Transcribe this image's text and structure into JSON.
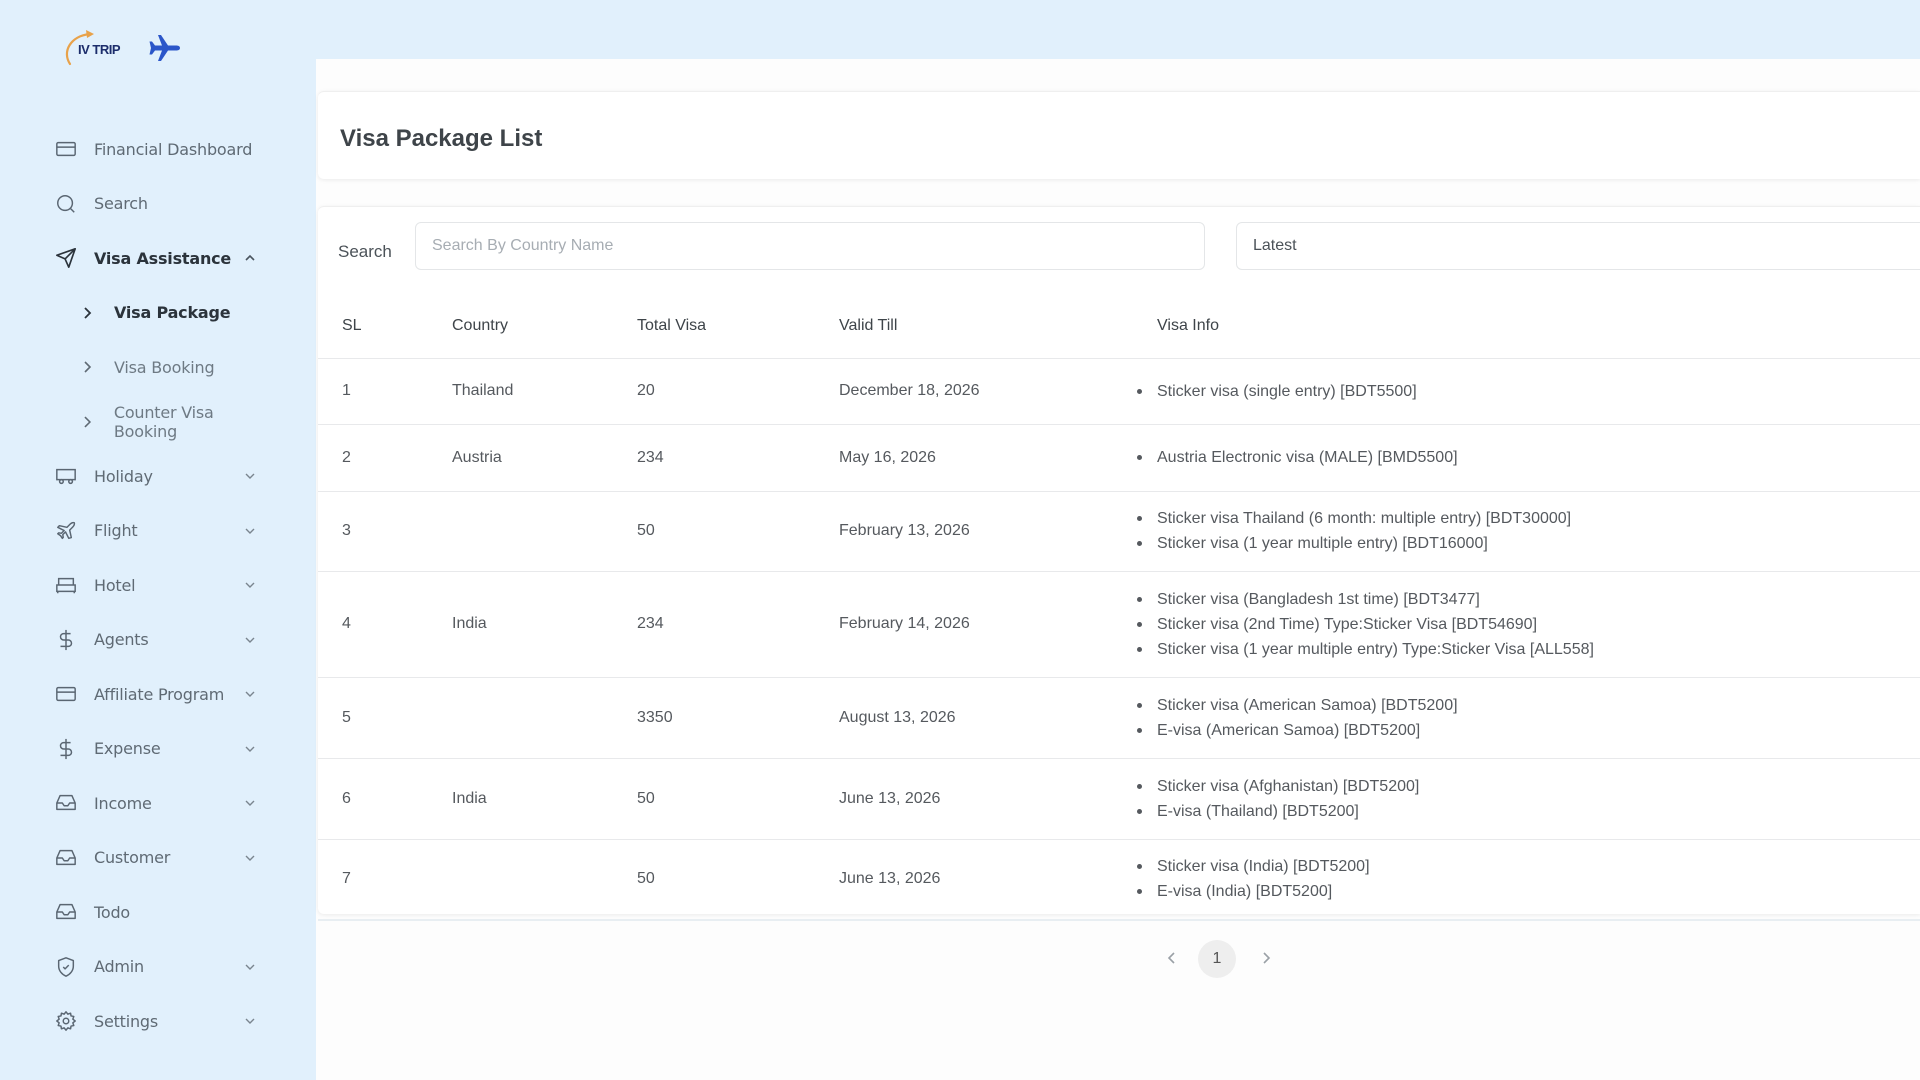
{
  "brand": {
    "name": "IV TRIP",
    "plane_color": "#2b56c9",
    "swoosh_color": "#e8a24a"
  },
  "sidebar": {
    "items": [
      {
        "label": "Financial Dashboard",
        "icon": "credit-card-icon",
        "has_chevron": false
      },
      {
        "label": "Search",
        "icon": "search-icon",
        "has_chevron": false
      },
      {
        "label": "Visa Assistance",
        "icon": "send-icon",
        "has_chevron": true,
        "expanded": true,
        "children": [
          {
            "label": "Visa Package",
            "active": true
          },
          {
            "label": "Visa Booking",
            "active": false
          },
          {
            "label": "Counter Visa Booking",
            "active": false
          }
        ]
      },
      {
        "label": "Holiday",
        "icon": "bus-icon",
        "has_chevron": true
      },
      {
        "label": "Flight",
        "icon": "plane-icon",
        "has_chevron": true
      },
      {
        "label": "Hotel",
        "icon": "bed-icon",
        "has_chevron": true
      },
      {
        "label": "Agents",
        "icon": "dollar-icon",
        "has_chevron": true
      },
      {
        "label": "Affiliate Program",
        "icon": "credit-card-icon",
        "has_chevron": true
      },
      {
        "label": "Expense",
        "icon": "dollar-icon",
        "has_chevron": true
      },
      {
        "label": "Income",
        "icon": "inbox-icon",
        "has_chevron": true
      },
      {
        "label": "Customer",
        "icon": "inbox-icon",
        "has_chevron": true
      },
      {
        "label": "Todo",
        "icon": "inbox-icon",
        "has_chevron": false
      },
      {
        "label": "Admin",
        "icon": "shield-check-icon",
        "has_chevron": true
      },
      {
        "label": "Settings",
        "icon": "gear-icon",
        "has_chevron": true
      }
    ]
  },
  "page": {
    "title": "Visa Package List"
  },
  "filters": {
    "search_label": "Search",
    "search_value": "",
    "search_placeholder": "Search By Country Name",
    "sort_value": "Latest"
  },
  "table": {
    "columns": [
      "SL",
      "Country",
      "Total Visa",
      "Valid Till",
      "Visa Info"
    ],
    "rows": [
      {
        "sl": "1",
        "country": "Thailand",
        "total_visa": "20",
        "valid_till": "December 18, 2026",
        "visa_info": [
          "Sticker visa (single entry) [BDT5500]"
        ]
      },
      {
        "sl": "2",
        "country": "Austria",
        "total_visa": "234",
        "valid_till": "May 16, 2026",
        "visa_info": [
          "Austria Electronic visa (MALE) [BMD5500]"
        ]
      },
      {
        "sl": "3",
        "country": "",
        "total_visa": "50",
        "valid_till": "February 13, 2026",
        "visa_info": [
          "Sticker visa Thailand (6 month: multiple entry) [BDT30000]",
          "Sticker visa (1 year multiple entry) [BDT16000]"
        ]
      },
      {
        "sl": "4",
        "country": "India",
        "total_visa": "234",
        "valid_till": "February 14, 2026",
        "visa_info": [
          "Sticker visa (Bangladesh 1st time) [BDT3477]",
          "Sticker visa (2nd Time) Type:Sticker Visa [BDT54690]",
          "Sticker visa (1 year multiple entry) Type:Sticker Visa [ALL558]"
        ]
      },
      {
        "sl": "5",
        "country": "",
        "total_visa": "3350",
        "valid_till": "August 13, 2026",
        "visa_info": [
          "Sticker visa (American Samoa) [BDT5200]",
          "E-visa (American Samoa) [BDT5200]"
        ]
      },
      {
        "sl": "6",
        "country": "India",
        "total_visa": "50",
        "valid_till": "June 13, 2026",
        "visa_info": [
          "Sticker visa (Afghanistan) [BDT5200]",
          "E-visa (Thailand) [BDT5200]"
        ]
      },
      {
        "sl": "7",
        "country": "",
        "total_visa": "50",
        "valid_till": "June 13, 2026",
        "visa_info": [
          "Sticker visa (India) [BDT5200]",
          "E-visa (India) [BDT5200]"
        ]
      }
    ]
  },
  "pagination": {
    "current_page": "1",
    "prev_icon": "chevron-left-icon",
    "next_icon": "chevron-right-icon"
  }
}
